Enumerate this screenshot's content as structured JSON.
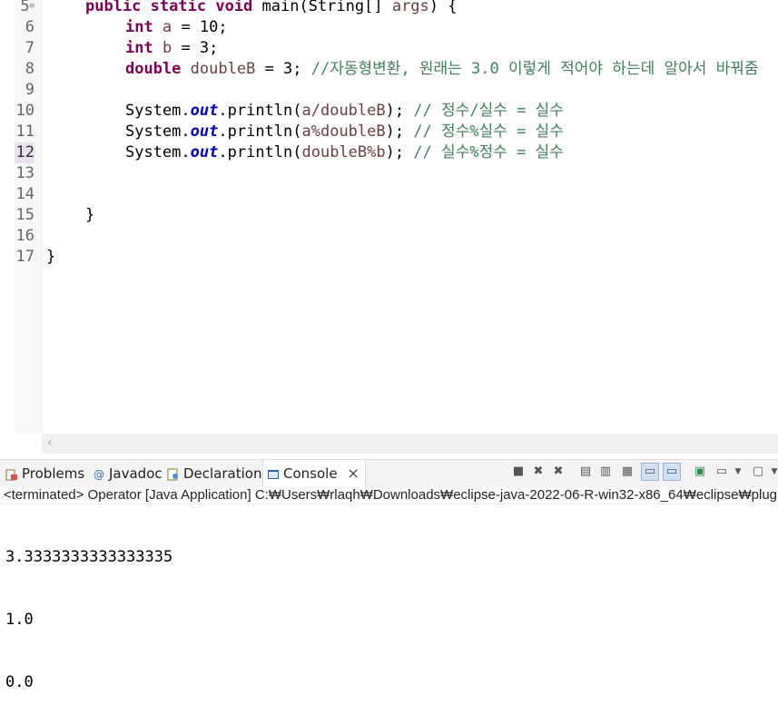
{
  "editor": {
    "lines": [
      {
        "num": "5",
        "folded": true
      },
      {
        "num": "6"
      },
      {
        "num": "7"
      },
      {
        "num": "8"
      },
      {
        "num": "9"
      },
      {
        "num": "10"
      },
      {
        "num": "11"
      },
      {
        "num": "12",
        "current": true
      },
      {
        "num": "13"
      },
      {
        "num": "14"
      },
      {
        "num": "15"
      },
      {
        "num": "16"
      },
      {
        "num": "17"
      }
    ],
    "code": {
      "l5": {
        "kw1": "public",
        "kw2": "static",
        "kw3": "void",
        "rest1": " main(String[] ",
        "args": "args",
        "rest2": ") {"
      },
      "l6": {
        "kw": "int",
        "var": "a",
        "rest": " = 10;"
      },
      "l7": {
        "kw": "int",
        "var": "b",
        "rest": " = 3;"
      },
      "l8": {
        "kw": "double",
        "var": "doubleB",
        "rest": " = 3; ",
        "comment": "//자동형변환, 원래는 3.0 이렇게 적어야 하는데 알아서 바꿔줌"
      },
      "l10": {
        "pre": "System.",
        "fld": "out",
        "mid": ".println(",
        "arg": "a/doubleB",
        "post": "); ",
        "comment": "// 정수/실수 = 실수"
      },
      "l11": {
        "pre": "System.",
        "fld": "out",
        "mid": ".println(",
        "arg": "a%doubleB",
        "post": "); ",
        "comment": "// 정수%실수 = 실수"
      },
      "l12": {
        "pre": "System.",
        "fld": "out",
        "mid": ".println(",
        "arg": "doubleB%b",
        "post": "); ",
        "comment": "// 실수%정수 = 실수"
      },
      "l15": "}",
      "l17": "}"
    }
  },
  "views": {
    "tabs": [
      {
        "label": "Problems",
        "icon": "problems-icon"
      },
      {
        "label": "Javadoc",
        "icon": "javadoc-icon"
      },
      {
        "label": "Declaration",
        "icon": "declaration-icon"
      },
      {
        "label": "Console",
        "icon": "console-icon",
        "active": true
      }
    ],
    "close_glyph": "×"
  },
  "console": {
    "status": "<terminated> Operator [Java Application] C:₩Users₩rlaqh₩Downloads₩eclipse-java-2022-06-R-win32-x86_64₩eclipse₩plugins",
    "output": [
      "3.3333333333333335",
      "1.0",
      "0.0"
    ]
  },
  "colors": {
    "keyword": "#7f0055",
    "field": "#0000c0",
    "comment": "#3f7f5f",
    "variable": "#6a3e3e"
  }
}
